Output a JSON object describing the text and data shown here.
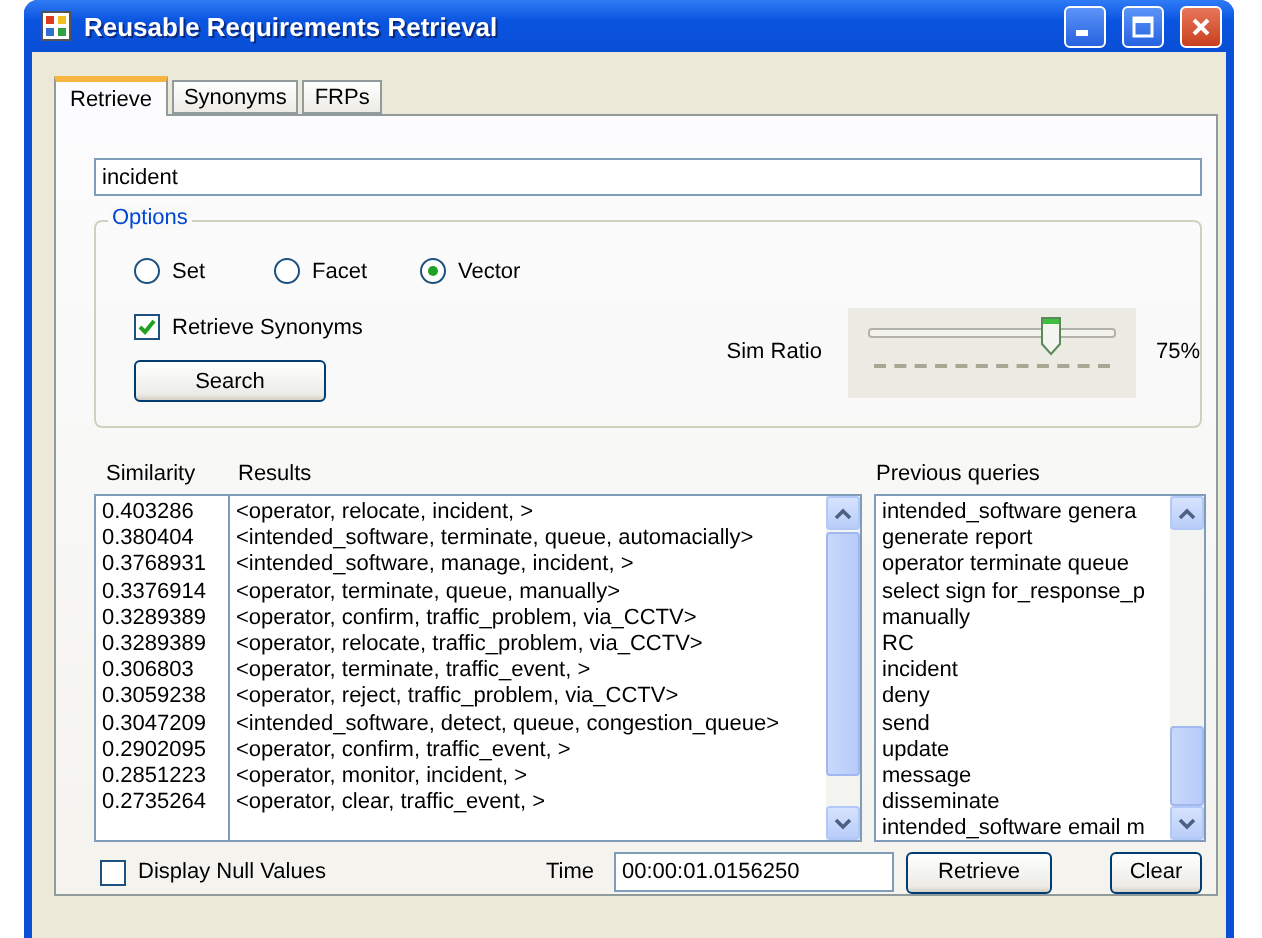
{
  "window": {
    "title": "Reusable Requirements Retrieval"
  },
  "tabs": [
    {
      "label": "Retrieve",
      "selected": true
    },
    {
      "label": "Synonyms",
      "selected": false
    },
    {
      "label": "FRPs",
      "selected": false
    }
  ],
  "query": {
    "value": "incident"
  },
  "options": {
    "title": "Options",
    "modes": [
      {
        "label": "Set",
        "selected": false
      },
      {
        "label": "Facet",
        "selected": false
      },
      {
        "label": "Vector",
        "selected": true
      }
    ],
    "retrieve_synonyms": {
      "label": "Retrieve Synonyms",
      "checked": true
    },
    "sim_ratio": {
      "label": "Sim Ratio",
      "level": 0.75,
      "reading": "75%"
    },
    "search_button": "Search"
  },
  "results": {
    "columns": [
      "Similarity",
      "Results"
    ],
    "rows": [
      {
        "similarity": "0.403286",
        "result": "<operator, relocate, incident, >"
      },
      {
        "similarity": "0.380404",
        "result": "<intended_software, terminate, queue, automacially>"
      },
      {
        "similarity": "0.3768931",
        "result": "<intended_software, manage, incident, >"
      },
      {
        "similarity": "0.3376914",
        "result": "<operator, terminate, queue, manually>"
      },
      {
        "similarity": "0.3289389",
        "result": "<operator, confirm, traffic_problem, via_CCTV>"
      },
      {
        "similarity": "0.3289389",
        "result": "<operator, relocate, traffic_problem, via_CCTV>"
      },
      {
        "similarity": "0.306803",
        "result": "<operator, terminate, traffic_event, >"
      },
      {
        "similarity": "0.3059238",
        "result": "<operator, reject, traffic_problem, via_CCTV>"
      },
      {
        "similarity": "0.3047209",
        "result": "<intended_software, detect, queue, congestion_queue>"
      },
      {
        "similarity": "0.2902095",
        "result": "<operator, confirm, traffic_event, >"
      },
      {
        "similarity": "0.2851223",
        "result": "<operator, monitor, incident, >"
      },
      {
        "similarity": "0.2735264",
        "result": "<operator, clear, traffic_event, >"
      }
    ]
  },
  "previous_queries": {
    "title": "Previous queries",
    "items": [
      "intended_software genera",
      "generate report",
      "operator terminate queue",
      "select sign for_response_p",
      "manually",
      "RC",
      "incident",
      "deny",
      "send",
      "update",
      "message",
      "disseminate",
      "intended_software email m"
    ]
  },
  "display_null": {
    "label": "Display Null Values",
    "checked": false
  },
  "time": {
    "label": "Time",
    "value": "00:00:01.0156250"
  },
  "buttons": [
    "Retrieve",
    "Clear"
  ]
}
